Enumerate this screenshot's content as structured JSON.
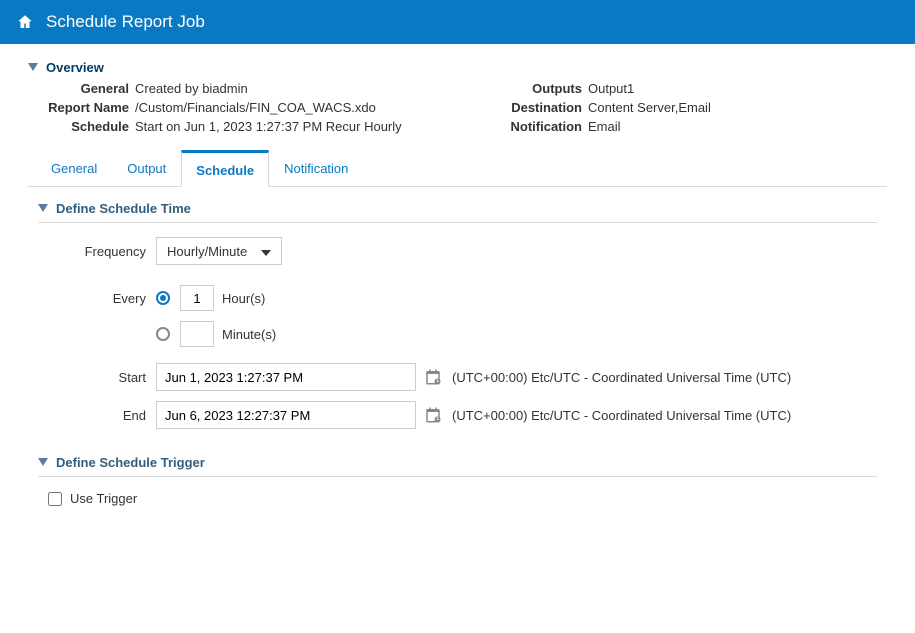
{
  "header": {
    "title": "Schedule Report Job"
  },
  "overview": {
    "heading": "Overview",
    "left": {
      "general_label": "General",
      "general_value": "Created by biadmin",
      "report_name_label": "Report Name",
      "report_name_value": "/Custom/Financials/FIN_COA_WACS.xdo",
      "schedule_label": "Schedule",
      "schedule_value": "Start on Jun 1, 2023 1:27:37 PM Recur Hourly"
    },
    "right": {
      "outputs_label": "Outputs",
      "outputs_value": "Output1",
      "destination_label": "Destination",
      "destination_value": "Content Server,Email",
      "notification_label": "Notification",
      "notification_value": "Email"
    }
  },
  "tabs": {
    "general": "General",
    "output": "Output",
    "schedule": "Schedule",
    "notification": "Notification"
  },
  "sched": {
    "heading": "Define Schedule Time",
    "frequency_label": "Frequency",
    "frequency_value": "Hourly/Minute",
    "every_label": "Every",
    "every_value": "1",
    "hours_label": "Hour(s)",
    "minutes_label": "Minute(s)",
    "start_label": "Start",
    "start_value": "Jun 1, 2023 1:27:37 PM",
    "start_tz": "(UTC+00:00) Etc/UTC - Coordinated Universal Time (UTC)",
    "end_label": "End",
    "end_value": "Jun 6, 2023 12:27:37 PM",
    "end_tz": "(UTC+00:00) Etc/UTC - Coordinated Universal Time (UTC)"
  },
  "trigger": {
    "heading": "Define Schedule Trigger",
    "use_trigger_label": "Use Trigger"
  }
}
